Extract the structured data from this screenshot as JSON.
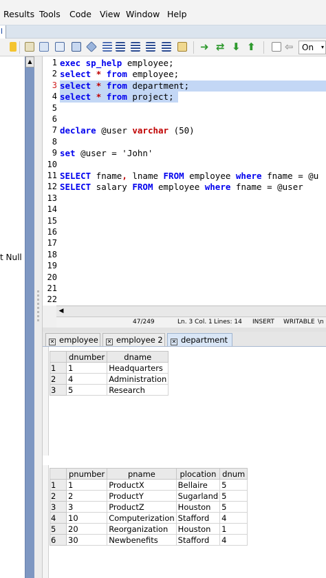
{
  "menu": {
    "items": [
      "Results",
      "Tools",
      "Code",
      "View",
      "Window",
      "Help"
    ]
  },
  "tabstrip": {
    "stub_label": "l"
  },
  "toolbar": {
    "mode_select_value": "On"
  },
  "left_panel": {
    "clipped_text": "t Null"
  },
  "editor": {
    "line_numbers": [
      "1",
      "2",
      "3",
      "4",
      "5",
      "6",
      "7",
      "8",
      "9",
      "10",
      "11",
      "12",
      "13",
      "14",
      "15",
      "16",
      "17",
      "18",
      "19",
      "20",
      "21",
      "22"
    ],
    "lines": [
      {
        "n": 1,
        "tokens": [
          [
            "kw",
            "exec"
          ],
          [
            "t",
            " "
          ],
          [
            "kw",
            "sp_help"
          ],
          [
            "t",
            " employee;"
          ]
        ]
      },
      {
        "n": 2,
        "tokens": [
          [
            "kw",
            "select"
          ],
          [
            "t",
            " "
          ],
          [
            "rk",
            "*"
          ],
          [
            "t",
            " "
          ],
          [
            "kw",
            "from"
          ],
          [
            "t",
            " employee;"
          ]
        ]
      },
      {
        "n": 3,
        "selected": true,
        "tokens": [
          [
            "kw",
            "select"
          ],
          [
            "t",
            " "
          ],
          [
            "rk",
            "*"
          ],
          [
            "t",
            " "
          ],
          [
            "kw",
            "from"
          ],
          [
            "t",
            " department;"
          ]
        ]
      },
      {
        "n": 4,
        "selected": true,
        "tokens": [
          [
            "kw",
            "select"
          ],
          [
            "t",
            " "
          ],
          [
            "rk",
            "*"
          ],
          [
            "t",
            " "
          ],
          [
            "kw",
            "from"
          ],
          [
            "t",
            " project;"
          ]
        ]
      },
      {
        "n": 7,
        "tokens": [
          [
            "kw",
            "declare"
          ],
          [
            "t",
            " @user "
          ],
          [
            "rk",
            "varchar"
          ],
          [
            "t",
            " (50)"
          ]
        ]
      },
      {
        "n": 9,
        "tokens": [
          [
            "kw",
            "set"
          ],
          [
            "t",
            " @user = 'John'"
          ]
        ]
      },
      {
        "n": 11,
        "tokens": [
          [
            "kw",
            "SELECT"
          ],
          [
            "t",
            " fname"
          ],
          [
            "rk",
            ","
          ],
          [
            "t",
            " lname "
          ],
          [
            "kw",
            "FROM"
          ],
          [
            "t",
            " employee "
          ],
          [
            "kw",
            "where"
          ],
          [
            "t",
            " fname = @u"
          ]
        ]
      },
      {
        "n": 12,
        "tokens": [
          [
            "kw",
            "SELECT"
          ],
          [
            "t",
            " salary "
          ],
          [
            "kw",
            "FROM"
          ],
          [
            "t",
            " employee "
          ],
          [
            "kw",
            "where"
          ],
          [
            "t",
            " fname = @user"
          ]
        ]
      }
    ]
  },
  "status": {
    "position": "47/249",
    "line_col": "Ln. 3 Col. 1",
    "lines": "Lines: 14",
    "mode": "INSERT",
    "access": "WRITABLE",
    "eol": "\\n"
  },
  "results": {
    "tabs": [
      "employee",
      "employee 2",
      "department"
    ],
    "active_tab": "department",
    "grid1": {
      "columns": [
        "dnumber",
        "dname"
      ],
      "rows": [
        [
          "1",
          "1",
          "Headquarters"
        ],
        [
          "2",
          "4",
          "Administration"
        ],
        [
          "3",
          "5",
          "Research"
        ]
      ]
    },
    "grid2": {
      "columns": [
        "pnumber",
        "pname",
        "plocation",
        "dnum"
      ],
      "rows": [
        [
          "1",
          "1",
          "ProductX",
          "Bellaire",
          "5"
        ],
        [
          "2",
          "2",
          "ProductY",
          "Sugarland",
          "5"
        ],
        [
          "3",
          "3",
          "ProductZ",
          "Houston",
          "5"
        ],
        [
          "4",
          "10",
          "Computerization",
          "Stafford",
          "4"
        ],
        [
          "5",
          "20",
          "Reorganization",
          "Houston",
          "1"
        ],
        [
          "6",
          "30",
          "Newbenefits",
          "Stafford",
          "4"
        ]
      ]
    }
  },
  "colors": {
    "keyword": "#0000ee",
    "reserved": "#c00000",
    "selection": "#c3d7f5",
    "scroll_accent": "#7e97c2"
  }
}
